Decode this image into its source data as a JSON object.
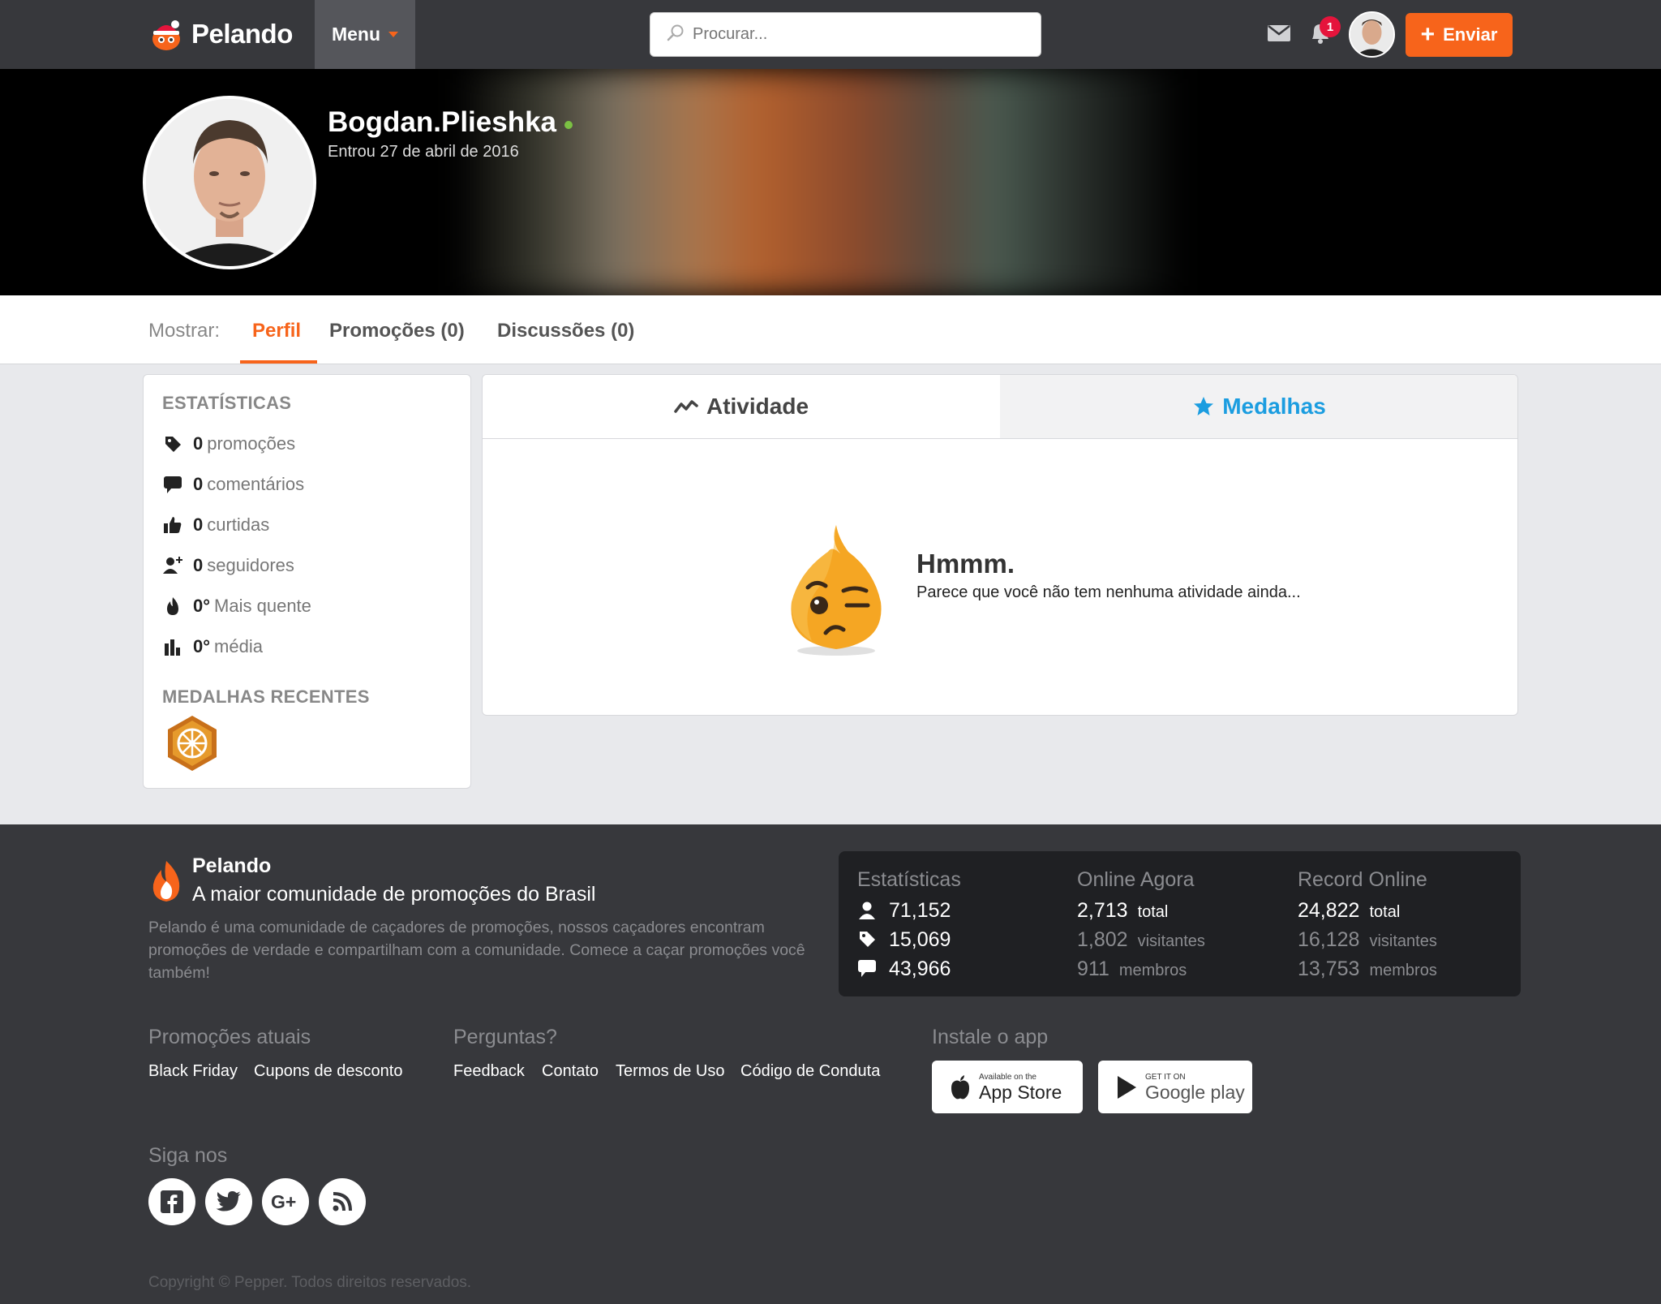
{
  "navbar": {
    "logo_text": "Pelando",
    "menu_label": "Menu",
    "search_placeholder": "Procurar...",
    "notification_count": "1",
    "submit_label": "Enviar",
    "brand_color": "#f7641b"
  },
  "profile": {
    "username": "Bogdan.Plieshka",
    "joined": "Entrou 27 de abril de 2016",
    "online_status_color": "#7bc043"
  },
  "tabs": {
    "show_label": "Mostrar:",
    "items": [
      {
        "label": "Perfil",
        "active": true
      },
      {
        "label": "Promoções (0)",
        "active": false
      },
      {
        "label": "Discussões (0)",
        "active": false
      }
    ]
  },
  "stats": {
    "title": "ESTATÍSTICAS",
    "rows": [
      {
        "icon": "tag-icon",
        "value": "0",
        "label": "promoções"
      },
      {
        "icon": "comment-icon",
        "value": "0",
        "label": "comentários"
      },
      {
        "icon": "thumbs-up-icon",
        "value": "0",
        "label": "curtidas"
      },
      {
        "icon": "followers-icon",
        "value": "0",
        "label": "seguidores"
      },
      {
        "icon": "flame-icon",
        "value": "0°",
        "label": "Mais quente"
      },
      {
        "icon": "bar-chart-icon",
        "value": "0°",
        "label": "média"
      }
    ],
    "recent_medals_title": "MEDALHAS RECENTES"
  },
  "activity": {
    "tabs": [
      {
        "label": "Atividade",
        "icon": "activity-icon"
      },
      {
        "label": "Medalhas",
        "icon": "star-icon"
      }
    ],
    "empty_title": "Hmmm.",
    "empty_message": "Parece que você não tem nenhuma atividade ainda..."
  },
  "footer": {
    "brand": "Pelando",
    "tagline": "A maior comunidade de promoções do Brasil",
    "description": "Pelando é uma comunidade de caçadores de promoções, nossos caçadores encontram promoções de verdade e compartilham com a comunidade. Comece a caçar promoções você também!",
    "stats": {
      "columns": [
        {
          "title": "Estatísticas",
          "rows": [
            {
              "icon": "user-icon",
              "value": "71,152"
            },
            {
              "icon": "tag-icon",
              "value": "15,069"
            },
            {
              "icon": "comment-icon",
              "value": "43,966"
            }
          ]
        },
        {
          "title": "Online Agora",
          "rows": [
            {
              "value": "2,713",
              "unit": "total"
            },
            {
              "value": "1,802",
              "unit": "visitantes"
            },
            {
              "value": "911",
              "unit": "membros"
            }
          ]
        },
        {
          "title": "Record Online",
          "rows": [
            {
              "value": "24,822",
              "unit": "total"
            },
            {
              "value": "16,128",
              "unit": "visitantes"
            },
            {
              "value": "13,753",
              "unit": "membros"
            }
          ]
        }
      ]
    },
    "promos_title": "Promoções atuais",
    "promos_links": [
      "Black Friday",
      "Cupons de desconto"
    ],
    "questions_title": "Perguntas?",
    "questions_links": [
      "Feedback",
      "Contato",
      "Termos de Uso",
      "Código de Conduta"
    ],
    "app_title": "Instale o app",
    "appstore_small": "Available on the",
    "appstore_big": "App Store",
    "googleplay_small": "GET IT ON",
    "googleplay_big": "Google play",
    "follow_title": "Siga nos",
    "social": [
      "facebook-icon",
      "twitter-icon",
      "google-plus-icon",
      "rss-icon"
    ],
    "copyright": "Copyright © Pepper. Todos direitos reservados."
  }
}
